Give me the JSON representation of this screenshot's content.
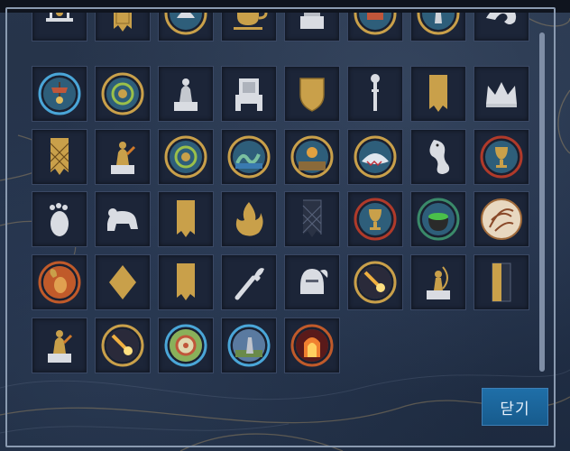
{
  "close_button_label": "닫기",
  "colors": {
    "gold": "#c9a04a",
    "gold_light": "#e2bd5e",
    "silver": "#d9dce2",
    "slot_bg": "#1c2538",
    "slot_border": "#3a4864",
    "button": "#1b659c"
  },
  "rows": [
    [
      "carousel-icon",
      "banner-icon",
      "offering-medallion-icon",
      "cup-icon",
      "stone-pedestal-icon",
      "altar-medallion-icon",
      "lighthouse-medallion-icon",
      "dragon-emblem-icon"
    ],
    [
      "fairground-medallion-icon",
      "gold-wreath-medallion-icon",
      "silver-statue-icon",
      "silver-throne-icon",
      "gold-shield-icon",
      "silver-scepter-icon",
      "gold-banner-icon",
      "silver-crown-icon"
    ],
    [
      "lattice-banner-icon",
      "gold-statue-icon",
      "gold-wreath-medallion-icon",
      "sea-serpent-medallion-icon",
      "deity-medallion-icon",
      "shark-medallion-icon",
      "silver-seahorse-dragon-icon",
      "chalice-medallion-icon"
    ],
    [
      "silver-footprint-icon",
      "silver-tiger-icon",
      "gold-banner-icon",
      "fire-emblem-icon",
      "mesh-banner-icon",
      "chalice-medallion-icon",
      "cauldron-medallion-icon",
      "shell-medallion-icon"
    ],
    [
      "ram-medallion-icon",
      "gold-diamond-icon",
      "gold-banner-icon",
      "silver-torch-icon",
      "silver-helmet-icon",
      "comet-medallion-icon",
      "gold-archer-statue-icon",
      "gold-half-banner-icon"
    ],
    [
      "gold-statue-icon",
      "comet-medallion-icon",
      "archery-target-medallion-icon",
      "knight-medallion-icon",
      "fire-portal-medallion-icon"
    ]
  ]
}
